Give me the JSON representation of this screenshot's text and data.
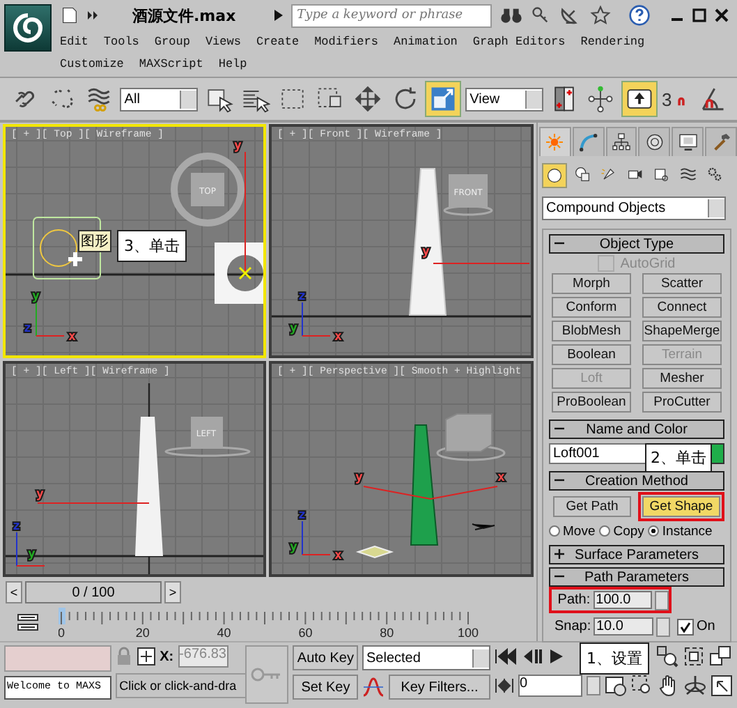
{
  "app_bar": {
    "file_name": "酒源文件.max",
    "search": {
      "placeholder": "Type a keyword or phrase"
    }
  },
  "menu_rows": [
    [
      "Edit",
      "Tools",
      "Group",
      "Views",
      "Create",
      "Modifiers",
      "Animation",
      "Graph Editors",
      "Rendering"
    ],
    [
      "Customize",
      "MAXScript",
      "Help"
    ]
  ],
  "toolbar": [
    {
      "kind": "icon",
      "selected": false
    },
    {
      "kind": "icon",
      "selected": false
    },
    {
      "kind": "icon",
      "selected": false
    },
    {
      "kind": "dropdown",
      "value": "All"
    },
    {
      "kind": "icon",
      "selected": false
    },
    {
      "kind": "icon",
      "selected": false
    },
    {
      "kind": "icon",
      "selected": false
    },
    {
      "kind": "icon",
      "selected": false
    },
    {
      "kind": "icon",
      "selected": false
    },
    {
      "kind": "icon",
      "selected": false
    },
    {
      "kind": "icon",
      "selected": true
    },
    {
      "kind": "dropdown",
      "value": "View"
    },
    {
      "kind": "icon",
      "selected": false
    },
    {
      "kind": "icon",
      "selected": false
    },
    {
      "kind": "icon",
      "selected": true
    },
    {
      "kind": "snap",
      "label": "3"
    },
    {
      "kind": "icon",
      "selected": false
    }
  ],
  "viewports": [
    {
      "label": "[ + ][ Top ][ Wireframe ]",
      "active": true,
      "cube_label": "TOP",
      "gizmo": [
        "y"
      ],
      "axes": [
        {
          "label": "y",
          "color": "#22aa22"
        },
        {
          "label": "z",
          "color": "#2233cc"
        },
        {
          "label": "x",
          "color": "#ff4a4a"
        }
      ],
      "tooltip": "图形",
      "callout": "3、单击"
    },
    {
      "label": "[ + ][ Front ][ Wireframe ]",
      "active": false,
      "cube_label": "FRONT",
      "gizmo": [
        "y"
      ],
      "axes": [
        {
          "label": "z",
          "color": "#2233cc"
        },
        {
          "label": "y",
          "color": "#22aa22"
        },
        {
          "label": "x",
          "color": "#ff4a4a"
        }
      ]
    },
    {
      "label": "[ + ][ Left ][ Wireframe ]",
      "active": false,
      "cube_label": "LEFT",
      "gizmo": [
        "y"
      ],
      "axes": [
        {
          "label": "z",
          "color": "#2233cc"
        },
        {
          "label": "y",
          "color": "#22aa22"
        }
      ]
    },
    {
      "label": "[ + ][ Perspective ][ Smooth + Highlight",
      "active": false,
      "gizmo": [
        "y",
        "x"
      ],
      "axes": [
        {
          "label": "z",
          "color": "#2233cc"
        },
        {
          "label": "y",
          "color": "#22aa22"
        },
        {
          "label": "x",
          "color": "#ff4a4a"
        }
      ]
    }
  ],
  "command_panel": {
    "tabs": [
      {
        "selected": true
      },
      {
        "selected": false
      },
      {
        "selected": false
      },
      {
        "selected": false
      },
      {
        "selected": false
      },
      {
        "selected": false
      }
    ],
    "categories": [
      {
        "selected": true
      },
      {
        "selected": false
      },
      {
        "selected": false
      },
      {
        "selected": false
      },
      {
        "selected": false
      },
      {
        "selected": false
      },
      {
        "selected": false
      }
    ],
    "object_class": "Compound Objects",
    "rollouts": [
      {
        "kind": "object_type",
        "title": "Object Type",
        "expanded": true,
        "autogrid": {
          "label": "AutoGrid",
          "checked": false,
          "disabled": true
        },
        "buttons": [
          {
            "label": "Morph",
            "disabled": false
          },
          {
            "label": "Scatter",
            "disabled": false
          },
          {
            "label": "Conform",
            "disabled": false
          },
          {
            "label": "Connect",
            "disabled": false
          },
          {
            "label": "BlobMesh",
            "disabled": false
          },
          {
            "label": "ShapeMerge",
            "disabled": false
          },
          {
            "label": "Boolean",
            "disabled": false
          },
          {
            "label": "Terrain",
            "disabled": true
          },
          {
            "label": "Loft",
            "disabled": true
          },
          {
            "label": "Mesher",
            "disabled": false
          },
          {
            "label": "ProBoolean",
            "disabled": false
          },
          {
            "label": "ProCutter",
            "disabled": false
          }
        ]
      },
      {
        "kind": "name_color",
        "title": "Name and Color",
        "expanded": true,
        "name": "Loft001",
        "color": "#1fae4a",
        "callout": "2、单击"
      },
      {
        "kind": "creation_method",
        "title": "Creation Method",
        "expanded": true,
        "buttons": [
          {
            "label": "Get Path",
            "selected": false,
            "highlighted": false
          },
          {
            "label": "Get Shape",
            "selected": true,
            "highlighted": true
          }
        ],
        "options": [
          {
            "label": "Move",
            "selected": false
          },
          {
            "label": "Copy",
            "selected": false
          },
          {
            "label": "Instance",
            "selected": true
          }
        ]
      },
      {
        "kind": "surface",
        "title": "Surface Parameters",
        "expanded": false
      },
      {
        "kind": "path_parameters",
        "title": "Path Parameters",
        "expanded": true,
        "path": {
          "label": "Path:",
          "value": "100.0",
          "highlighted": true
        },
        "snap": {
          "label": "Snap:",
          "value": "10.0"
        },
        "on": {
          "label": "On",
          "checked": true
        },
        "callout": "1、设置"
      }
    ]
  },
  "timeline": {
    "prev": "<",
    "position": "0 / 100",
    "next": ">",
    "ruler_labels": [
      "0",
      "20",
      "40",
      "60",
      "80",
      "100"
    ]
  },
  "status": {
    "welcome": "Welcome to MAXS",
    "x_label": "X:",
    "x_value": "-676.83",
    "prompt": "Click or click-and-dra",
    "auto_key": "Auto Key",
    "set_key": "Set Key",
    "key_mode": "Selected",
    "key_filters": "Key Filters...",
    "frame": "0"
  }
}
